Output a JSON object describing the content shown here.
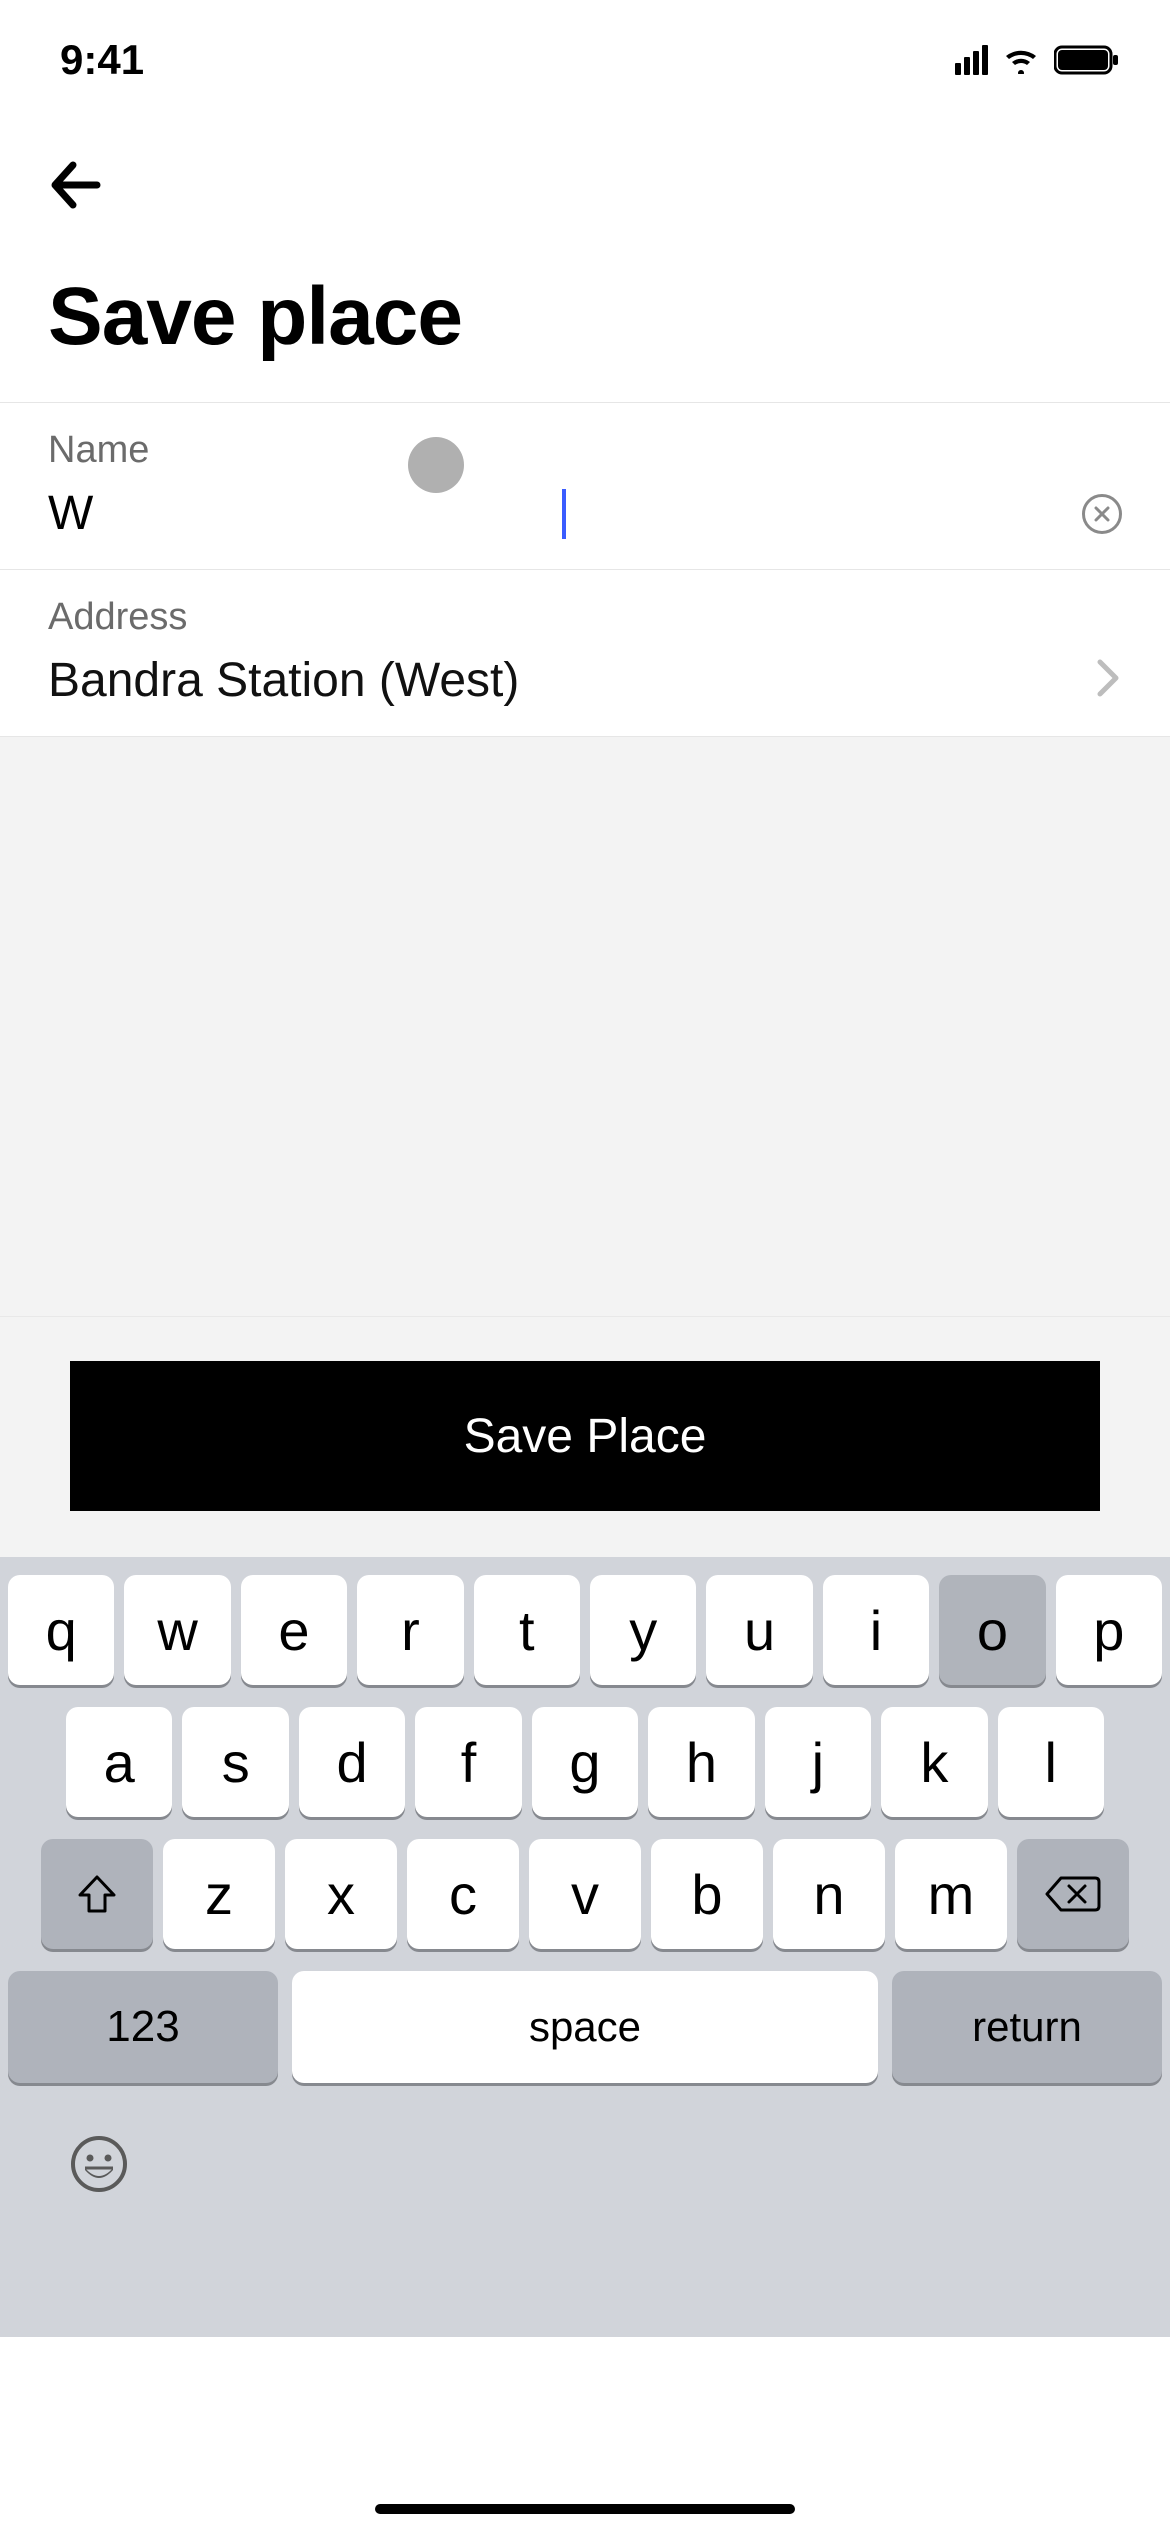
{
  "status": {
    "time": "9:41"
  },
  "page": {
    "title": "Save place"
  },
  "form": {
    "name_label": "Name",
    "name_value": "W",
    "address_label": "Address",
    "address_value": "Bandra Station (West)"
  },
  "cta": {
    "save_label": "Save Place"
  },
  "keyboard": {
    "row1": [
      "q",
      "w",
      "e",
      "r",
      "t",
      "y",
      "u",
      "i",
      "o",
      "p"
    ],
    "row2": [
      "a",
      "s",
      "d",
      "f",
      "g",
      "h",
      "j",
      "k",
      "l"
    ],
    "row3": [
      "z",
      "x",
      "c",
      "v",
      "b",
      "n",
      "m"
    ],
    "numbers_label": "123",
    "space_label": "space",
    "return_label": "return",
    "pressed_key": "o"
  }
}
